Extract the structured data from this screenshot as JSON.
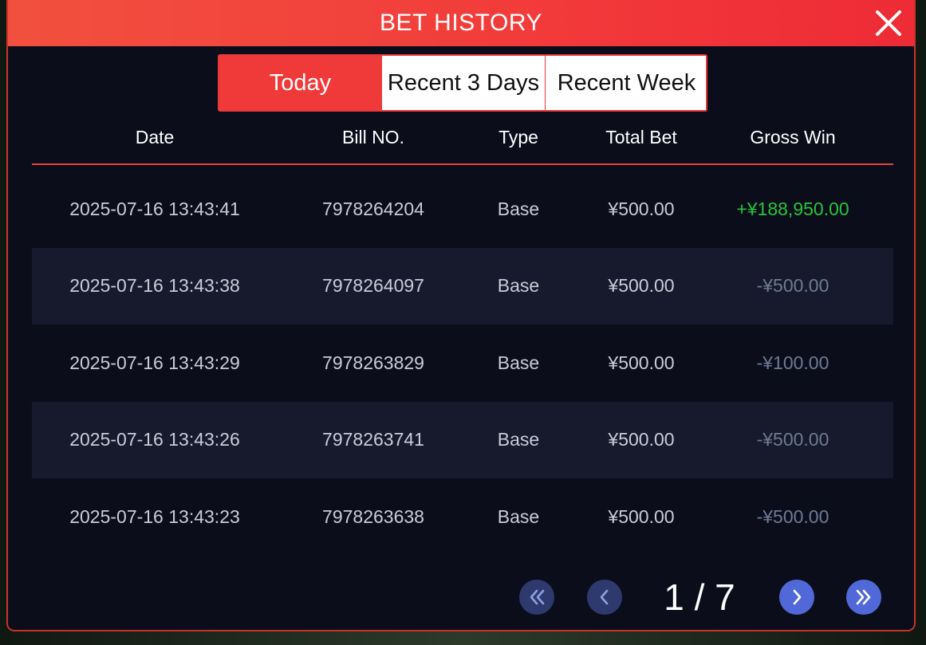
{
  "modal": {
    "title": "BET HISTORY"
  },
  "tabs": [
    {
      "label": "Today",
      "active": true
    },
    {
      "label": "Recent 3 Days",
      "active": false
    },
    {
      "label": "Recent Week",
      "active": false
    }
  ],
  "table": {
    "columns": [
      "Date",
      "Bill NO.",
      "Type",
      "Total Bet",
      "Gross Win"
    ],
    "rows": [
      {
        "date": "2025-07-16 13:43:41",
        "bill_no": "7978264204",
        "type": "Base",
        "total_bet": "¥500.00",
        "gross_win": "+¥188,950.00",
        "result": "win"
      },
      {
        "date": "2025-07-16 13:43:38",
        "bill_no": "7978264097",
        "type": "Base",
        "total_bet": "¥500.00",
        "gross_win": "-¥500.00",
        "result": "loss"
      },
      {
        "date": "2025-07-16 13:43:29",
        "bill_no": "7978263829",
        "type": "Base",
        "total_bet": "¥500.00",
        "gross_win": "-¥100.00",
        "result": "loss"
      },
      {
        "date": "2025-07-16 13:43:26",
        "bill_no": "7978263741",
        "type": "Base",
        "total_bet": "¥500.00",
        "gross_win": "-¥500.00",
        "result": "loss"
      },
      {
        "date": "2025-07-16 13:43:23",
        "bill_no": "7978263638",
        "type": "Base",
        "total_bet": "¥500.00",
        "gross_win": "-¥500.00",
        "result": "loss"
      }
    ]
  },
  "pagination": {
    "indicator": "1 / 7",
    "current_page": 1,
    "total_pages": 7,
    "icons": {
      "first": "double-chevron-left-icon",
      "prev": "chevron-left-icon",
      "next": "chevron-right-icon",
      "last": "double-chevron-right-icon"
    }
  },
  "colors": {
    "accent": "#f03a3a",
    "win": "#27c43a",
    "loss": "#6d7b94",
    "background": "#0b0d1b",
    "row_alt": "#161a2c",
    "pager_dim": "#2e3a6e",
    "pager_bright": "#5169d8"
  }
}
